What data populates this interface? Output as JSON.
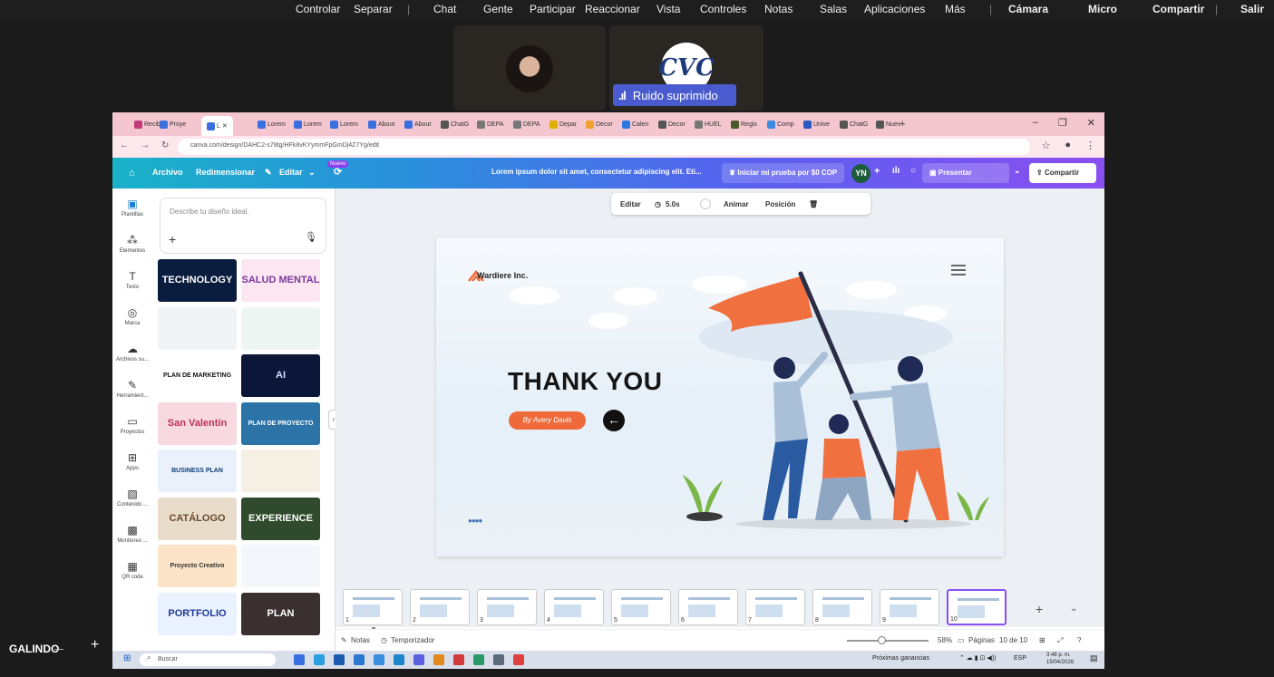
{
  "teams": {
    "menu": [
      "Controlar",
      "Separar",
      "Chat",
      "Gente",
      "Participar",
      "Reaccionar",
      "Vista",
      "Controles",
      "Notas",
      "Salas",
      "Aplicaciones",
      "Más"
    ],
    "camera": "Cámara",
    "mic": "Micro",
    "share": "Compartir",
    "leave": "Salir",
    "noise_label": "Ruido suprimido",
    "logo_text": "CVC",
    "participant_name": "GALINDO"
  },
  "browser": {
    "tabs": [
      {
        "label": "Recib",
        "color": "#c23a7a"
      },
      {
        "label": "Proye",
        "color": "#3b6fe0"
      },
      {
        "label": "L",
        "color": "#3b6fe0"
      },
      {
        "label": "Lorem",
        "color": "#3b6fe0"
      },
      {
        "label": "Lorem",
        "color": "#3b6fe0"
      },
      {
        "label": "Lorem",
        "color": "#3b6fe0"
      },
      {
        "label": "About",
        "color": "#3b6fe0"
      },
      {
        "label": "About",
        "color": "#3b6fe0"
      },
      {
        "label": "ChatG",
        "color": "#555"
      },
      {
        "label": "DEPA",
        "color": "#777"
      },
      {
        "label": "DEPA",
        "color": "#777"
      },
      {
        "label": "Depar",
        "color": "#e0b000"
      },
      {
        "label": "Decor",
        "color": "#f0a030"
      },
      {
        "label": "Calen",
        "color": "#2a7ae0"
      },
      {
        "label": "Decor",
        "color": "#555"
      },
      {
        "label": "HUEL",
        "color": "#777"
      },
      {
        "label": "Regis",
        "color": "#4a5a2a"
      },
      {
        "label": "Comp",
        "color": "#3a8ae0"
      },
      {
        "label": "Unive",
        "color": "#2a5ac0"
      },
      {
        "label": "ChatG",
        "color": "#555"
      },
      {
        "label": "Nuev",
        "color": "#555"
      }
    ],
    "url": "canva.com/design/DAHC2-s78tg/HFk8vKYymmFpGmDj4Z7Yg/edit"
  },
  "canva": {
    "toolbar": {
      "archivo": "Archivo",
      "redimensionar": "Redimensionar",
      "editar": "Editar",
      "nuevo": "Nuevo",
      "title": "Lorem ipsum dolor sit amet, consectetur adipiscing elit. Eti...",
      "trial": "Iniciar mi prueba por $0 COP",
      "initials": "YN",
      "present": "Presentar",
      "share": "Compartir"
    },
    "rail": [
      "Plantillas",
      "Elementos",
      "Texto",
      "Marca",
      "Archivos su...",
      "Herramient...",
      "Proyectos",
      "Apps",
      "Contenido ...",
      "Monitoreo ...",
      "QR code"
    ],
    "describe_placeholder": "Describe tu diseño ideal.",
    "templates": [
      {
        "text": "TECHNOLOGY",
        "bg": "#0b1d3f",
        "fg": "#fff"
      },
      {
        "text": "SALUD MENTAL",
        "bg": "#fbe6f2",
        "fg": "#7a3a9a"
      },
      {
        "text": "",
        "bg": "#f1f3f7",
        "fg": "#333"
      },
      {
        "text": "",
        "bg": "#eef6f3",
        "fg": "#333"
      },
      {
        "text": "PLAN DE MARKETING",
        "bg": "#ffffff",
        "fg": "#111"
      },
      {
        "text": "AI",
        "bg": "#0c1638",
        "fg": "#cfe0ff"
      },
      {
        "text": "San Valentín",
        "bg": "#f7d9df",
        "fg": "#c0325a"
      },
      {
        "text": "PLAN DE PROYECTO",
        "bg": "#2c74a8",
        "fg": "#fff"
      },
      {
        "text": "BUSINESS PLAN",
        "bg": "#eaf1fa",
        "fg": "#0b3d7a"
      },
      {
        "text": "",
        "bg": "#f6efe4",
        "fg": "#333"
      },
      {
        "text": "CATÁLOGO",
        "bg": "#e9dccb",
        "fg": "#6a4a2a"
      },
      {
        "text": "EXPERIENCE",
        "bg": "#2f4a2c",
        "fg": "#fff"
      },
      {
        "text": "Proyecto Creativo",
        "bg": "#fbe4c7",
        "fg": "#333"
      },
      {
        "text": "",
        "bg": "#f3f6fb",
        "fg": "#333"
      },
      {
        "text": "PORTFOLIO",
        "bg": "#eaf1ff",
        "fg": "#1e3a9a"
      },
      {
        "text": "PLAN",
        "bg": "#3a3030",
        "fg": "#fff"
      }
    ],
    "context_toolbar": {
      "edit": "Editar",
      "duration": "5.0s",
      "animate": "Animar",
      "position": "Posición"
    },
    "slide": {
      "brand": "Wardiere Inc.",
      "title": "THANK YOU",
      "byline": "By Avery Davis",
      "accent": "#ee6a3a"
    },
    "filmstrip": [
      "1",
      "2",
      "3",
      "4",
      "5",
      "6",
      "7",
      "8",
      "9",
      "10"
    ],
    "bottom": {
      "notes": "Notas",
      "timer": "Temporizador",
      "zoom": "58%",
      "pages": "Páginas",
      "page_count": "10 de 10"
    }
  },
  "taskbar": {
    "search": "Buscar",
    "earnings": "Próximas ganancias",
    "lang": "ESP",
    "time": "3:48 p. m.",
    "date": "15/04/2026"
  }
}
